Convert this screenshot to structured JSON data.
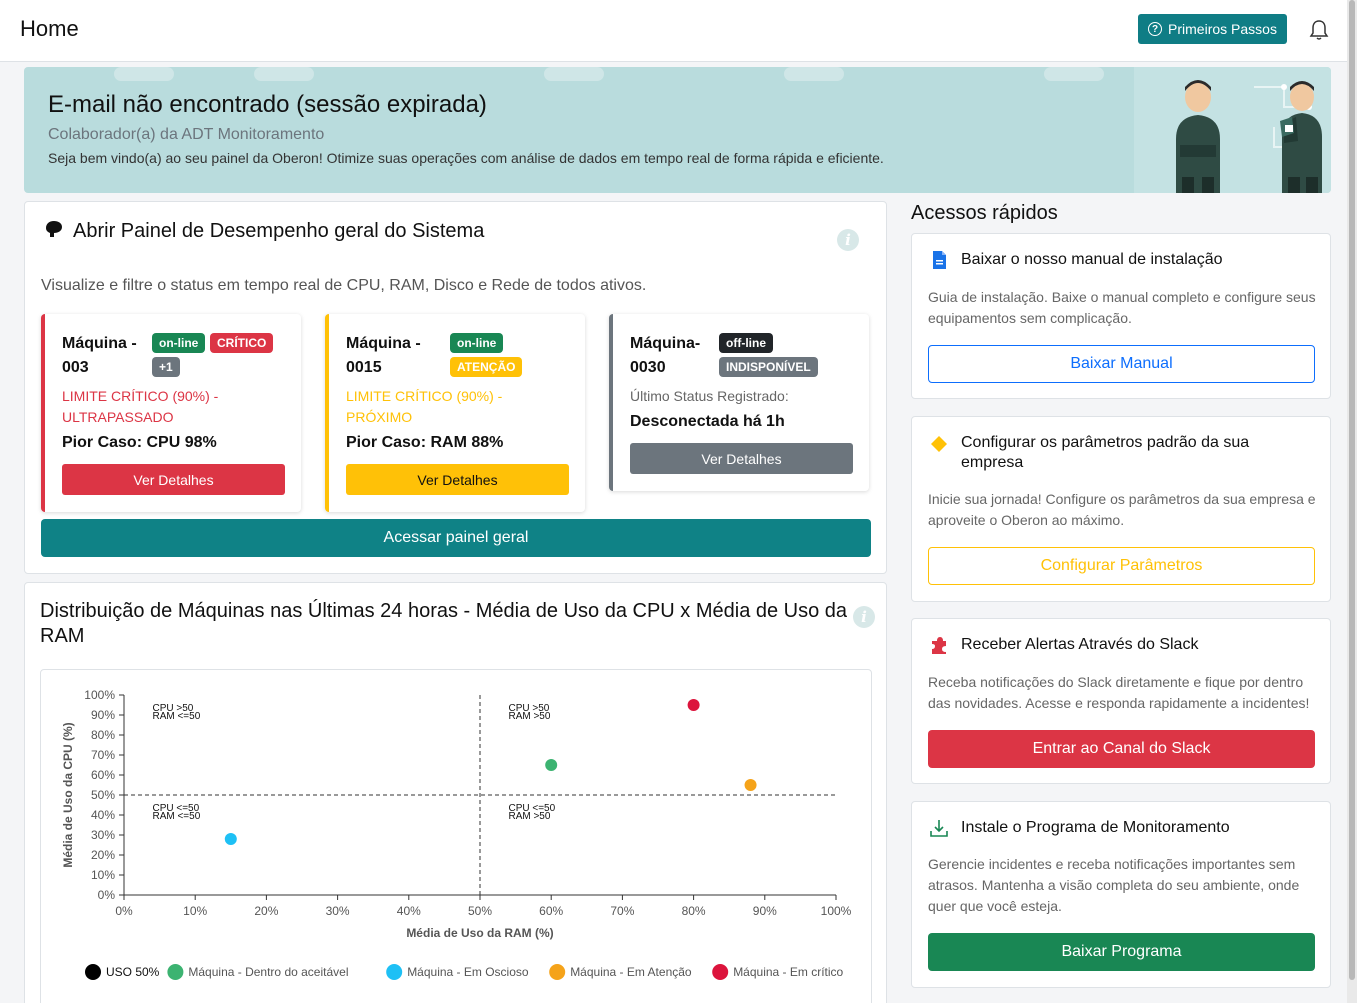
{
  "header": {
    "title": "Home",
    "primeiros_passos": "Primeiros Passos"
  },
  "banner": {
    "title": "E-mail não encontrado (sessão expirada)",
    "role": "Colaborador(a) da ADT Monitoramento",
    "welcome": "Seja bem vindo(a) ao seu painel da Oberon! Otimize suas operações com análise de dados em tempo real de forma rápida e eficiente."
  },
  "performance": {
    "title": "Abrir Painel de Desempenho geral do Sistema",
    "description": "Visualize e filtre o status em tempo real de CPU, RAM, Disco e Rede de todos ativos.",
    "machines": [
      {
        "name": "Máquina - 003",
        "badges": [
          "on-line",
          "CRÍTICO",
          "+1"
        ],
        "limit": "LIMITE CRÍTICO (90%) - ULTRAPASSADO",
        "worst": "Pior Caso: CPU 98%",
        "button": "Ver Detalhes",
        "color": "#dc3545"
      },
      {
        "name": "Máquina - 0015",
        "badges": [
          "on-line",
          "ATENÇÃO"
        ],
        "limit": "LIMITE CRÍTICO (90%) - PRÓXIMO",
        "worst": "Pior Caso: RAM 88%",
        "button": "Ver Detalhes",
        "color": "#ffc107"
      },
      {
        "name": "Máquina- 0030",
        "badges": [
          "off-line",
          "INDISPONÍVEL"
        ],
        "last_status_label": "Último Status Registrado:",
        "last_status": "Desconectada há 1h",
        "button": "Ver Detalhes",
        "color": "#6c757d"
      }
    ],
    "access_button": "Acessar painel geral"
  },
  "distribution": {
    "title": "Distribuição de Máquinas nas Últimas 24 horas - Média de Uso da CPU x Média de Uso da RAM"
  },
  "chart_data": {
    "type": "scatter",
    "xlabel": "Média de Uso da RAM (%)",
    "ylabel": "Média de Uso da CPU (%)",
    "xlim": [
      0,
      100
    ],
    "ylim": [
      0,
      100
    ],
    "xticks": [
      "0%",
      "10%",
      "20%",
      "30%",
      "40%",
      "50%",
      "60%",
      "70%",
      "80%",
      "90%",
      "100%"
    ],
    "yticks": [
      "0%",
      "10%",
      "20%",
      "30%",
      "40%",
      "50%",
      "60%",
      "70%",
      "80%",
      "90%",
      "100%"
    ],
    "threshold": 50,
    "quadrant_labels": [
      {
        "lines": [
          "CPU >50",
          "RAM <=50"
        ],
        "quadrant": "top-left"
      },
      {
        "lines": [
          "CPU >50",
          "RAM >50"
        ],
        "quadrant": "top-right"
      },
      {
        "lines": [
          "CPU <=50",
          "RAM <=50"
        ],
        "quadrant": "bottom-left"
      },
      {
        "lines": [
          "CPU <=50",
          "RAM >50"
        ],
        "quadrant": "bottom-right"
      }
    ],
    "series": [
      {
        "name": "USO 50%",
        "color": "#000000",
        "points": []
      },
      {
        "name": "Máquina - Dentro do aceitável",
        "color": "#3cb371",
        "points": [
          [
            60,
            65
          ]
        ]
      },
      {
        "name": "Máquina - Em Oscioso",
        "color": "#1ec0f5",
        "points": [
          [
            15,
            28
          ]
        ]
      },
      {
        "name": "Máquina - Em Atenção",
        "color": "#f5a31a",
        "points": [
          [
            88,
            55
          ]
        ]
      },
      {
        "name": "Máquina - Em crítico",
        "color": "#dc143c",
        "points": [
          [
            80,
            95
          ]
        ]
      }
    ],
    "legend_position": "bottom"
  },
  "quick_access": {
    "title": "Acessos rápidos",
    "cards": [
      {
        "title": "Baixar o nosso manual de instalação",
        "text": "Guia de instalação. Baixe o manual completo e configure seus equipamentos sem complicação.",
        "button": "Baixar Manual",
        "icon": "document-icon"
      },
      {
        "title": "Configurar os parâmetros padrão da sua empresa",
        "text": "Inicie sua jornada! Configure os parâmetros da sua empresa e aproveite o Oberon ao máximo.",
        "button": "Configurar Parâmetros",
        "icon": "diamond-icon"
      },
      {
        "title": "Receber Alertas Através do Slack",
        "text": "Receba notificações do Slack diretamente e fique por dentro das novidades. Acesse e responda rapidamente a incidentes!",
        "button": "Entrar ao Canal do Slack",
        "icon": "puzzle-icon"
      },
      {
        "title": "Instale o Programa de Monitoramento",
        "text": "Gerencie incidentes e receba notificações importantes sem atrasos. Mantenha a visão completa do seu ambiente, onde quer que você esteja.",
        "button": "Baixar Programa",
        "icon": "download-icon"
      }
    ]
  }
}
